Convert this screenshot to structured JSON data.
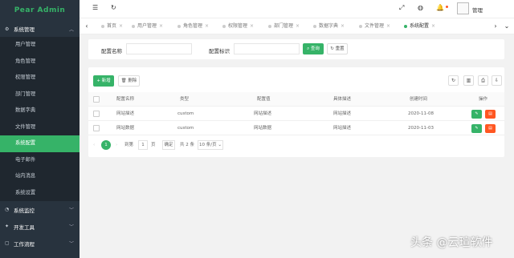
{
  "app": {
    "logo": "Pear Admin"
  },
  "sidebar": {
    "group_system": "系统管理",
    "items": [
      "用户管理",
      "角色管理",
      "权限管理",
      "部门管理",
      "数据字典",
      "文件管理",
      "系统配置",
      "电子邮件",
      "站内消息",
      "系统设置"
    ],
    "active_item": "系统配置",
    "groups": [
      "系统监控",
      "开发工具",
      "工作流程"
    ]
  },
  "header": {
    "user": "管理"
  },
  "tabs": {
    "items": [
      "首页",
      "用户管理",
      "角色管理",
      "权限管理",
      "部门管理",
      "数据字典",
      "文件管理",
      "系统配置"
    ],
    "active": "系统配置"
  },
  "search": {
    "label_name": "配置名称",
    "label_code": "配置标识",
    "query_btn": "查询",
    "reset_btn": "重置"
  },
  "toolbar": {
    "add": "新增",
    "delete": "删除"
  },
  "table": {
    "columns": [
      "配置名称",
      "类型",
      "配置值",
      "具体描述",
      "创建时间",
      "操作"
    ],
    "rows": [
      {
        "name": "网站描述",
        "type": "custom",
        "value": "网站描述",
        "desc": "网站描述",
        "time": "2020-11-08"
      },
      {
        "name": "网站数据",
        "type": "custom",
        "value": "网站数据",
        "desc": "网站描述",
        "time": "2020-11-03"
      }
    ]
  },
  "pager": {
    "current": "1",
    "goto_label": "到第",
    "goto_value": "1",
    "page_label": "页",
    "confirm": "确定",
    "total": "共 2 条",
    "page_size": "10 条/页"
  },
  "watermark": "头条 @云瑄软件",
  "colors": {
    "accent": "#36b368",
    "danger": "#ff5722",
    "sidebar_bg": "#28333e"
  }
}
